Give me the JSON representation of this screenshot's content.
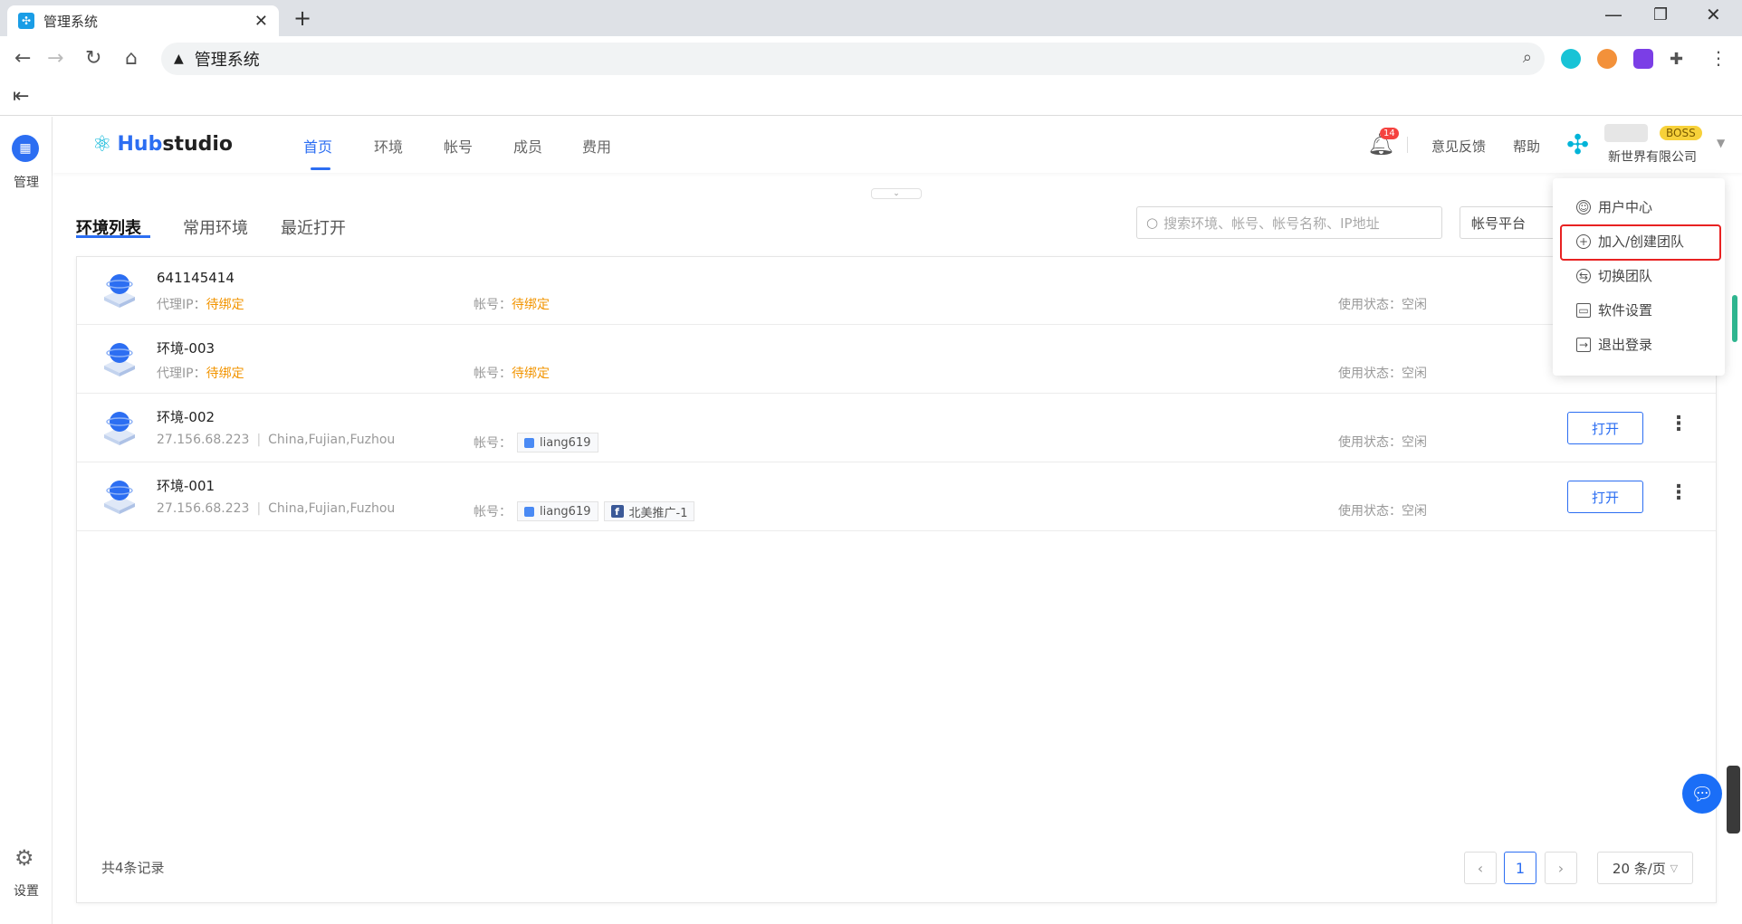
{
  "browser": {
    "tab_title": "管理系统",
    "address": "管理系统"
  },
  "rail": {
    "manage_label": "管理",
    "settings_label": "设置"
  },
  "header": {
    "logo_hub": "Hub",
    "logo_studio": "studio",
    "nav": [
      "首页",
      "环境",
      "帐号",
      "成员",
      "费用"
    ],
    "notifications": "14",
    "feedback": "意见反馈",
    "help": "帮助",
    "role_badge": "BOSS",
    "company": "新世界有限公司"
  },
  "subtabs": [
    "环境列表",
    "常用环境",
    "最近打开"
  ],
  "search": {
    "placeholder": "搜索环境、帐号、帐号名称、IP地址"
  },
  "platform_filter": "帐号平台",
  "labels": {
    "proxy": "代理IP：",
    "account": "帐号：",
    "status": "使用状态："
  },
  "rows": [
    {
      "name": "641145414",
      "proxy": "待绑定",
      "account": "待绑定",
      "status": "空闲"
    },
    {
      "name": "环境-003",
      "proxy": "待绑定",
      "account": "待绑定",
      "status": "空闲"
    },
    {
      "name": "环境-002",
      "ip": "27.156.68.223",
      "location": "China,Fujian,Fuzhou",
      "accounts": [
        "liang619"
      ],
      "status": "空闲",
      "open": "打开"
    },
    {
      "name": "环境-001",
      "ip": "27.156.68.223",
      "location": "China,Fujian,Fuzhou",
      "accounts": [
        "liang619",
        "北美推广-1"
      ],
      "status": "空闲",
      "open": "打开"
    }
  ],
  "footer": {
    "total": "共4条记录",
    "page": "1",
    "page_size": "20 条/页"
  },
  "dropdown": {
    "items": [
      "用户中心",
      "加入/创建团队",
      "切换团队",
      "软件设置",
      "退出登录"
    ]
  },
  "colors": {
    "accent": "#2c6ef2",
    "pending": "#f29400",
    "highlight": "#e82222"
  }
}
